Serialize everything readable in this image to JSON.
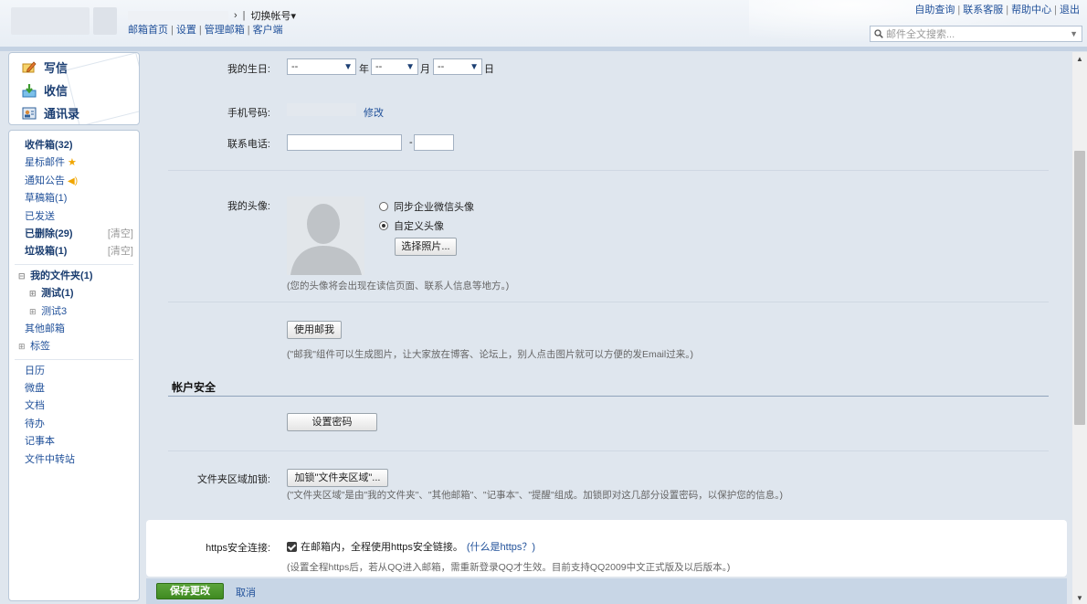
{
  "header": {
    "switch_account": "切换帐号▾",
    "links": [
      "邮箱首页",
      "设置",
      "管理邮箱",
      "客户端"
    ],
    "top_links": [
      "自助查询",
      "联系客服",
      "帮助中心",
      "退出"
    ],
    "search_placeholder": "邮件全文搜索..."
  },
  "nav_top": {
    "compose": "写信",
    "inbox": "收信",
    "contacts": "通讯录"
  },
  "nav": {
    "inbox": "收件箱(32)",
    "starred": "星标邮件",
    "notices": "通知公告",
    "drafts": "草稿箱(1)",
    "sent": "已发送",
    "deleted": "已删除(29)",
    "spam": "垃圾箱(1)",
    "clear": "[清空]",
    "my_folders": "我的文件夹(1)",
    "folder1": "测试(1)",
    "folder2": "测试3",
    "other_mailboxes": "其他邮箱",
    "tags": "标签",
    "calendar": "日历",
    "drive": "微盘",
    "docs": "文档",
    "todo": "待办",
    "notes": "记事本",
    "file_transfer": "文件中转站"
  },
  "profile": {
    "birthday_label": "我的生日:",
    "year_value": "--",
    "month_value": "--",
    "day_value": "--",
    "year_unit": "年",
    "month_unit": "月",
    "day_unit": "日",
    "phone_label": "手机号码:",
    "phone_edit": "修改",
    "tel_label": "联系电话:",
    "tel_dash": "-",
    "avatar_label": "我的头像:",
    "avatar_opt1": "同步企业微信头像",
    "avatar_opt2": "自定义头像",
    "choose_photo": "选择照片...",
    "avatar_hint": "(您的头像将会出现在读信页面、联系人信息等地方。)",
    "use_mailme": "使用邮我",
    "mailme_hint": "(\"邮我\"组件可以生成图片，让大家放在博客、论坛上，别人点击图片就可以方便的发Email过来。)"
  },
  "security": {
    "title": "帐户安全",
    "set_password": "设置密码",
    "folder_lock_label": "文件夹区域加锁:",
    "folder_lock_button": "加锁\"文件夹区域\"...",
    "folder_lock_hint": "(\"文件夹区域\"是由\"我的文件夹\"、\"其他邮箱\"、\"记事本\"、\"提醒\"组成。加锁即对这几部分设置密码，以保护您的信息。)",
    "https_label": "https安全连接:",
    "https_checkbox": "在邮箱内，全程使用https安全链接。",
    "https_link": "(什么是https？)",
    "https_hint": "(设置全程https后，若从QQ进入邮箱，需重新登录QQ才生效。目前支持QQ2009中文正式版及以后版本。)"
  },
  "footer": {
    "save": "保存更改",
    "cancel": "取消"
  },
  "colors": {
    "link": "#21519a",
    "save_green": "#4a962b",
    "panel_bg": "#dfe6ee"
  }
}
